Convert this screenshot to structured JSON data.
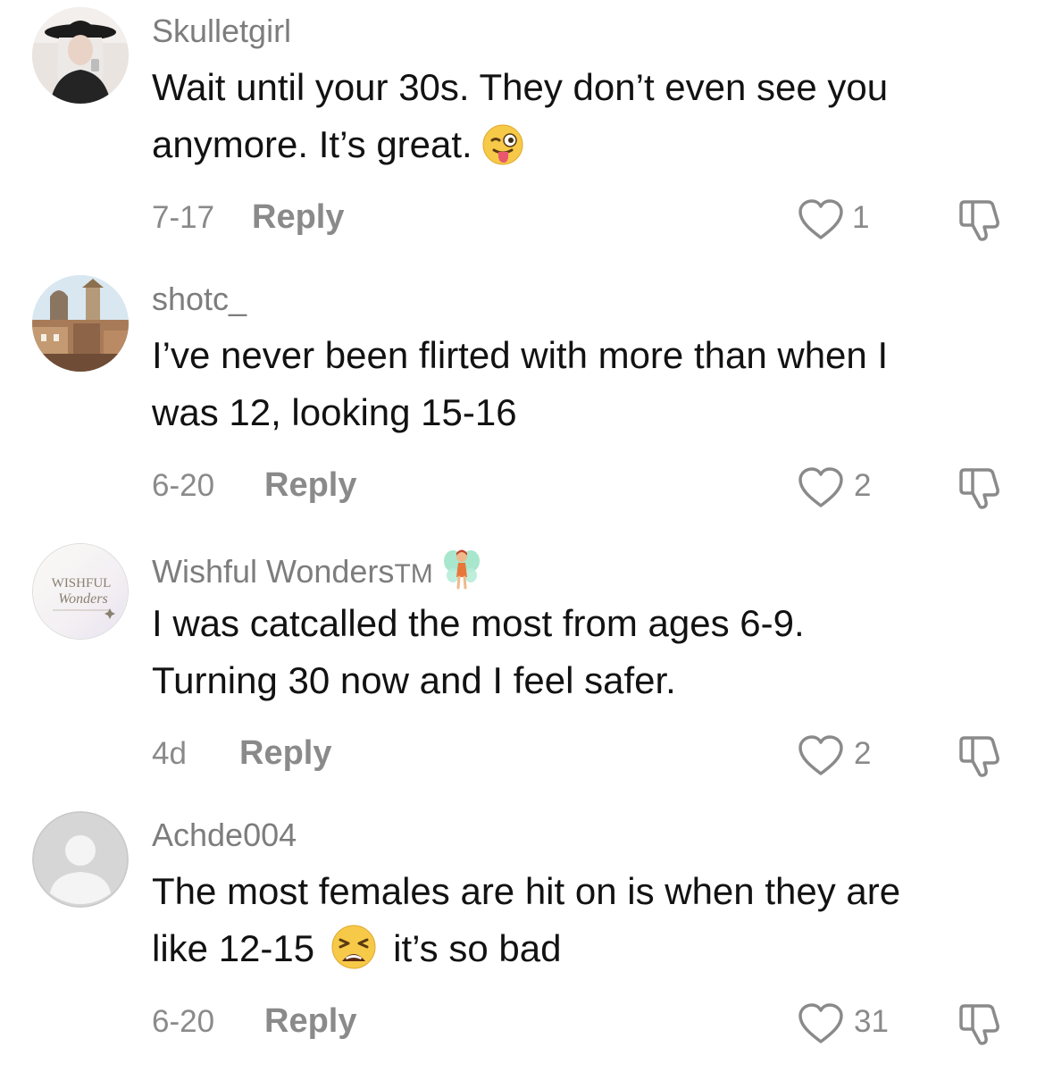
{
  "comments": [
    {
      "username": "Skulletgirl",
      "lines": [
        "Wait until your 30s. They don’t even see you",
        "anymore. It’s great."
      ],
      "emoji": "winking-face-with-tongue",
      "date": "7-17",
      "reply_label": "Reply",
      "likes": "1"
    },
    {
      "username": "shotc_",
      "lines": [
        "I’ve never been flirted with more than when I",
        "was 12, looking 15-16"
      ],
      "date": "6-20",
      "reply_label": "Reply",
      "likes": "2"
    },
    {
      "username": "Wishful Wonders",
      "username_suffix": "TM",
      "badge_emoji": "fairy",
      "avatar_logo_line1": "WISHFUL",
      "avatar_logo_line2": "Wonders",
      "lines": [
        "I was catcalled the most from ages 6-9.",
        "Turning 30 now and I feel safer."
      ],
      "date": "4d",
      "reply_label": "Reply",
      "likes": "2"
    },
    {
      "username": "Achde004",
      "lines": [
        "The most females are hit on is when they are",
        "like 12-15",
        "it’s so bad"
      ],
      "emoji": "weary-face",
      "date": "6-20",
      "reply_label": "Reply",
      "likes": "31"
    }
  ],
  "colors": {
    "text": "#121212",
    "secondary": "#8a8a8a",
    "username": "#7d7d7d",
    "background": "#ffffff"
  },
  "icons": [
    "heart-outline-icon",
    "thumbs-down-outline-icon"
  ]
}
